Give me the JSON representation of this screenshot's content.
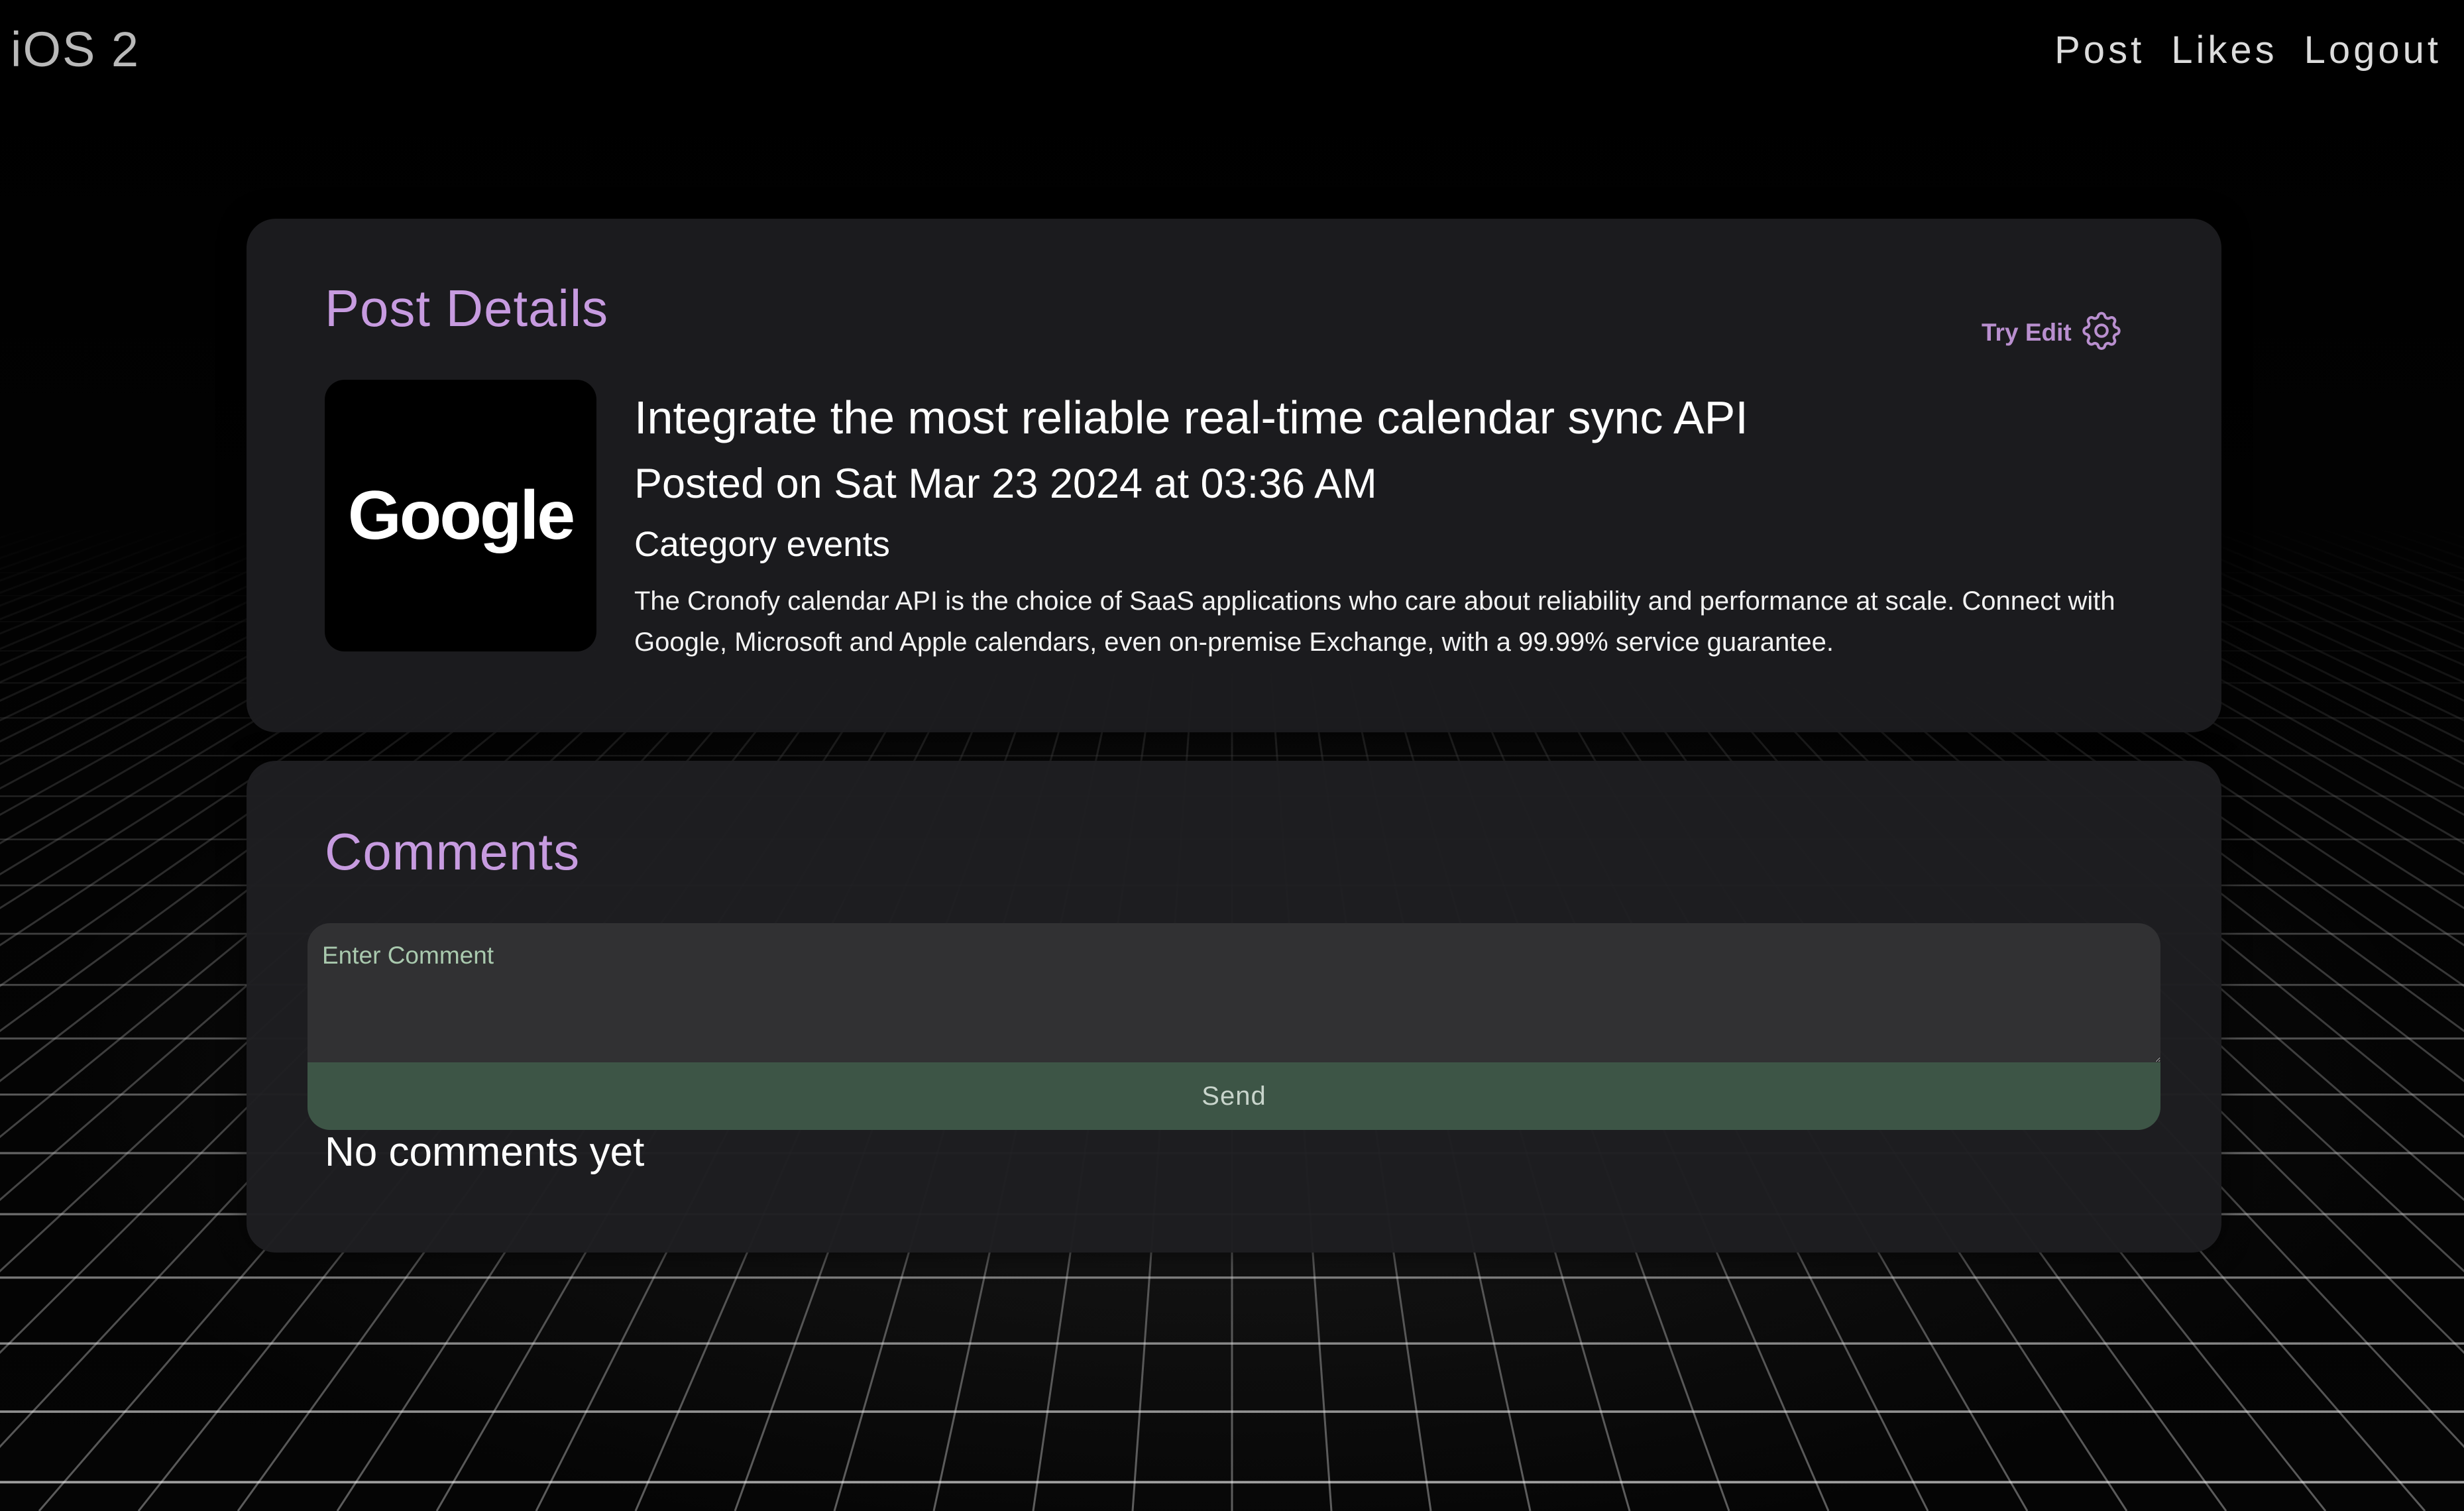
{
  "header": {
    "brand": "iOS 2",
    "nav": [
      {
        "label": "Post"
      },
      {
        "label": "Likes"
      },
      {
        "label": "Logout"
      }
    ]
  },
  "post_details": {
    "heading": "Post Details",
    "edit_label": "Try Edit",
    "edit_icon": "gear-icon",
    "logo_text": "Google",
    "title": "Integrate the most reliable real-time calendar sync API",
    "posted": "Posted on Sat Mar 23 2024 at 03:36 AM",
    "category": "Category events",
    "description": "The Cronofy calendar API is the choice of SaaS applications who care about reliability and performance at scale. Connect with Google, Microsoft and Apple calendars, even on-premise Exchange, with a 99.99% service guarantee."
  },
  "comments": {
    "heading": "Comments",
    "input_placeholder": "Enter Comment",
    "send_label": "Send",
    "empty_text": "No comments yet"
  },
  "colors": {
    "accent": "#c79be0",
    "send_button": "#3d5546",
    "card": "#1c1c1f",
    "background": "#000000"
  }
}
